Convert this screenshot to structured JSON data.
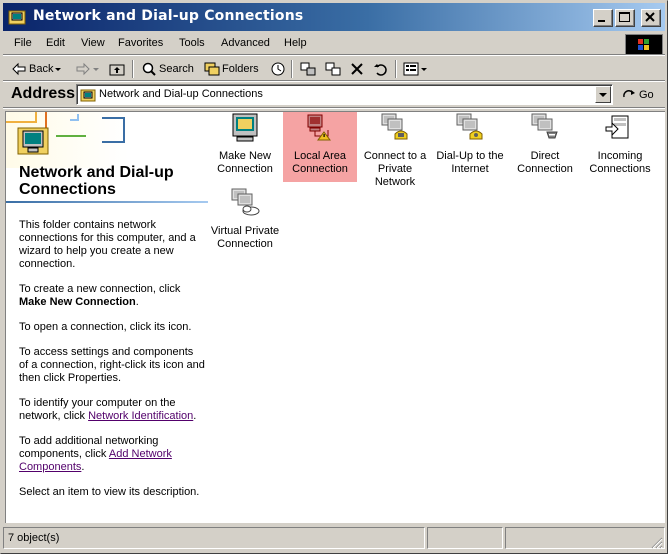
{
  "window": {
    "title": "Network and Dial-up Connections"
  },
  "menu": [
    "File",
    "Edit",
    "View",
    "Favorites",
    "Tools",
    "Advanced",
    "Help"
  ],
  "toolbar": {
    "back_label": "Back",
    "search_label": "Search",
    "folders_label": "Folders"
  },
  "address": {
    "label": "Address",
    "value": "Network and Dial-up Connections",
    "go_label": "Go"
  },
  "leftpane": {
    "title": "Network and Dial-up Connections",
    "intro": "This folder contains network connections for this computer, and a wizard to help you create a new connection.",
    "create_text": "To create a new connection, click",
    "create_bold": "Make New Connection",
    "open_text": "To open a connection, click its icon.",
    "settings_text": "To access settings and components of a connection, right-click its icon and then click Properties.",
    "identify_text": "To identify your computer on the network, click",
    "identify_link": "Network Identification",
    "add_text": "To add additional networking components, click",
    "add_link": "Add Network Components",
    "select_text": "Select an item to view its description."
  },
  "icons": [
    {
      "label": "Make New Connection",
      "icon": "make-new-connection-icon",
      "selected": false
    },
    {
      "label": "Local Area Connection",
      "icon": "local-area-connection-icon",
      "selected": true
    },
    {
      "label": "Connect to a Private Network",
      "icon": "connect-private-network-icon",
      "selected": false
    },
    {
      "label": "Dial-Up to the Internet",
      "icon": "dial-up-internet-icon",
      "selected": false
    },
    {
      "label": "Direct Connection",
      "icon": "direct-connection-icon",
      "selected": false
    },
    {
      "label": "Incoming Connections",
      "icon": "incoming-connections-icon",
      "selected": false
    },
    {
      "label": "Virtual Private Connection",
      "icon": "virtual-private-connection-icon",
      "selected": false
    }
  ],
  "status": {
    "count": "7 object(s)"
  },
  "colors": {
    "titlebar_start": "#0a246a",
    "titlebar_end": "#a6caf0",
    "selection": "#f5a3a3",
    "link": "#52006b",
    "chrome": "#d4d0c8"
  }
}
